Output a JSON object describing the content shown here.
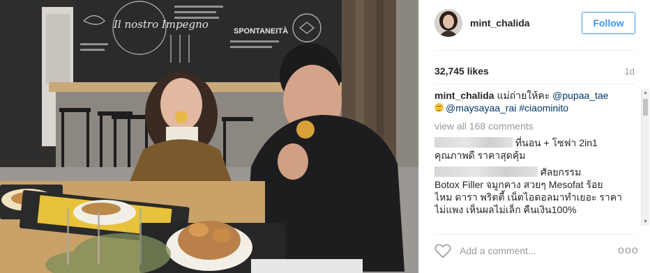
{
  "post": {
    "username": "mint_chalida",
    "follow_label": "Follow",
    "likes": "32,745 likes",
    "age": "1d",
    "caption": {
      "author": "mint_chalida",
      "text_before": " แม่ถ่ายให้คะ ",
      "mention_1": "@pupaa_tae",
      "mention_2": "@maysayaa_rai",
      "hashtag": "#ciaominito"
    },
    "view_all_comments": "view all 168 comments",
    "comments": [
      {
        "visible_text_line1": "ที่นอน + โซฟา 2in1",
        "visible_text_line2": "คุณภาพดี ราคาสุดคุ้ม"
      },
      {
        "visible_text_line1": "ศัลยกรรม",
        "visible_text_line2": "Botox Filler จมูกคาง สวยๆ Mesofat ร้อย",
        "visible_text_line3": "ไหม ดารา พริตตี้ เน็ตไอดอลมาทำเยอะ ราคา",
        "visible_text_line4": "ไม่แพง เห็นผลไม่เล็ก คืนเงิน100%"
      }
    ],
    "add_comment_placeholder": "Add a comment...",
    "more_label": "ooo",
    "colors": {
      "link": "#003569",
      "follow_blue": "#3897f0",
      "muted": "#999999"
    },
    "icons": {
      "like": "heart-icon",
      "options": "more-options-icon"
    }
  },
  "photo": {
    "wall_sign_title": "Il nostro Impegno",
    "wall_sign_right": "SPONTANEITÀ"
  }
}
